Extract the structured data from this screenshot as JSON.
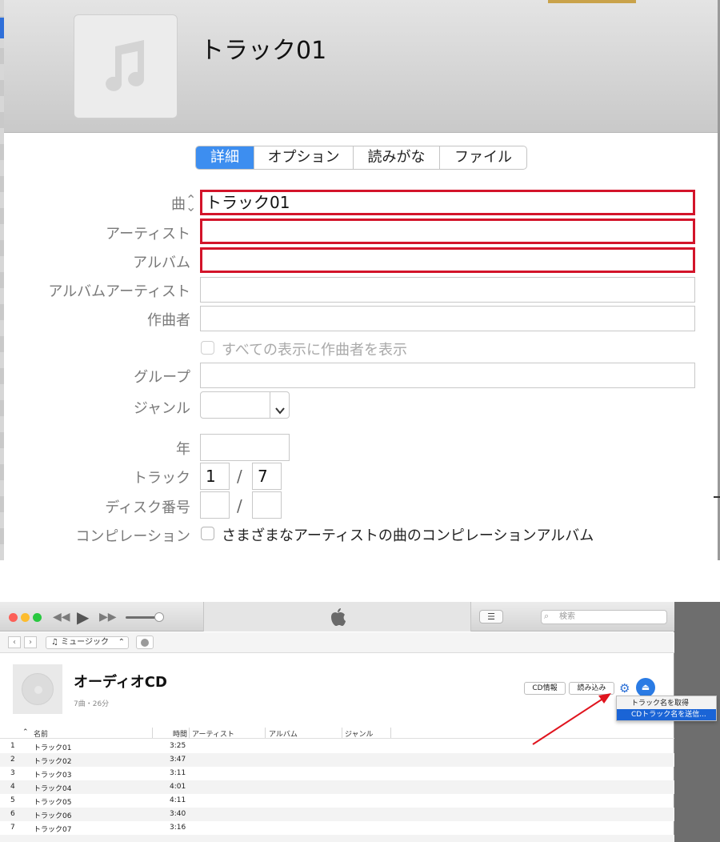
{
  "dialog": {
    "track_title": "トラック01",
    "tabs": [
      {
        "label": "詳細",
        "active": true
      },
      {
        "label": "オプション",
        "active": false
      },
      {
        "label": "読みがな",
        "active": false
      },
      {
        "label": "ファイル",
        "active": false
      }
    ],
    "fields": {
      "song_label": "曲",
      "song_value": "トラック01",
      "artist_label": "アーティスト",
      "artist_value": "",
      "album_label": "アルバム",
      "album_value": "",
      "album_artist_label": "アルバムアーティスト",
      "album_artist_value": "",
      "composer_label": "作曲者",
      "composer_value": "",
      "show_composer_label": "すべての表示に作曲者を表示",
      "grouping_label": "グループ",
      "grouping_value": "",
      "genre_label": "ジャンル",
      "genre_value": "",
      "year_label": "年",
      "year_value": "",
      "track_label": "トラック",
      "track_number": "1",
      "track_total": "7",
      "disc_label": "ディスク番号",
      "disc_number": "",
      "disc_total": "",
      "separator": "/",
      "compilation_label": "コンピレーション",
      "compilation_text": "さまざまなアーティストの曲のコンピレーションアルバム"
    },
    "highlight_color": "#d3142a",
    "accent_color": "#3d8ef0"
  },
  "itunes": {
    "search_placeholder": "検索",
    "media_kind": "ミュージック",
    "album_title": "オーディオCD",
    "album_meta": "7曲・26分",
    "cd_info_label": "CD情報",
    "import_label": "読み込み",
    "menu": {
      "items": [
        "トラック名を取得",
        "CDトラック名を送信..."
      ],
      "selected_index": 1
    },
    "columns": [
      "名前",
      "時間",
      "アーティスト",
      "アルバム",
      "ジャンル"
    ],
    "tracks": [
      {
        "num": "1",
        "name": "トラック01",
        "time": "3:25"
      },
      {
        "num": "2",
        "name": "トラック02",
        "time": "3:47"
      },
      {
        "num": "3",
        "name": "トラック03",
        "time": "3:11"
      },
      {
        "num": "4",
        "name": "トラック04",
        "time": "4:01"
      },
      {
        "num": "5",
        "name": "トラック05",
        "time": "4:11"
      },
      {
        "num": "6",
        "name": "トラック06",
        "time": "3:40"
      },
      {
        "num": "7",
        "name": "トラック07",
        "time": "3:16"
      }
    ],
    "annotation_arrow_color": "#e0141e"
  }
}
